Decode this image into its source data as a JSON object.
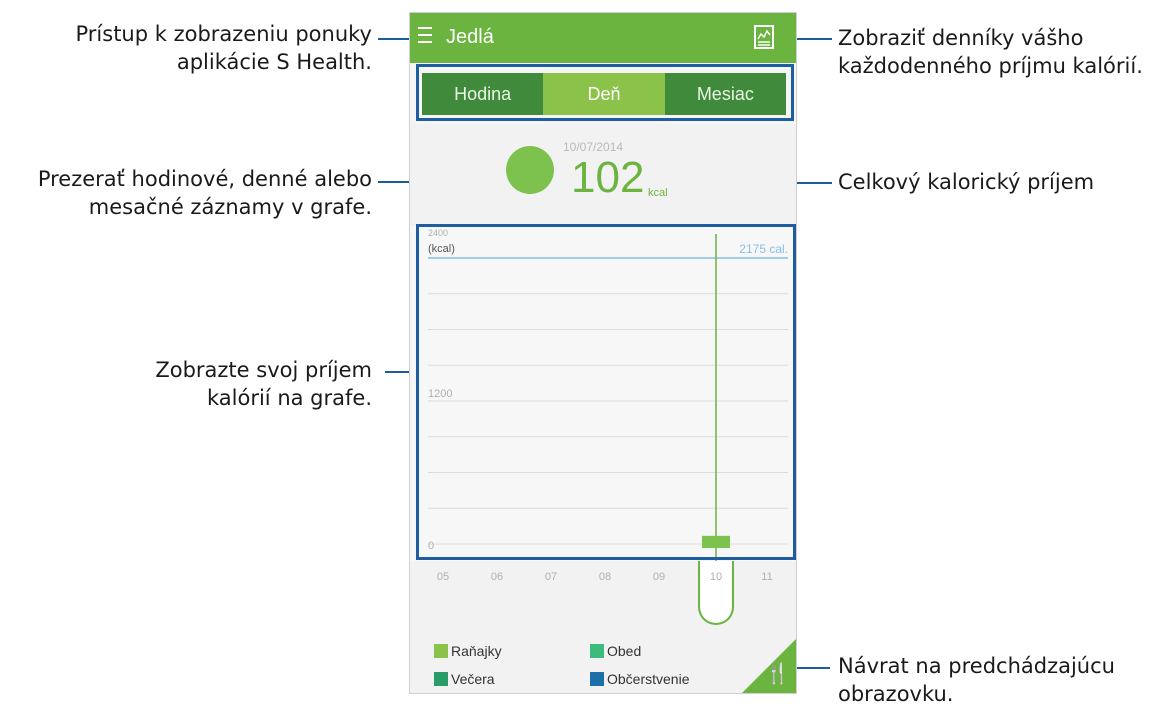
{
  "app": {
    "title": "Jedlá"
  },
  "tabs": [
    {
      "label": "Hodina",
      "active": false
    },
    {
      "label": "Deň",
      "active": true
    },
    {
      "label": "Mesiac",
      "active": false
    }
  ],
  "summary": {
    "date": "10/07/2014",
    "value": "102",
    "unit": "kcal"
  },
  "graph": {
    "top_label": "2400",
    "unit_label": "(kcal)",
    "goal_label": "2175 cal.",
    "mid_tick": "1200",
    "zero_tick": "0",
    "x_ticks": [
      "05",
      "06",
      "07",
      "08",
      "09",
      "10",
      "11"
    ],
    "selected_tick": "10"
  },
  "chart_data": {
    "type": "bar",
    "categories": [
      "05",
      "06",
      "07",
      "08",
      "09",
      "10",
      "11"
    ],
    "values": [
      0,
      0,
      0,
      0,
      0,
      102,
      0
    ],
    "ylabel": "(kcal)",
    "ylim": [
      0,
      2400
    ],
    "goal": 2175,
    "grid": true
  },
  "legend": [
    {
      "label": "Raňajky",
      "color": "#8bc34a"
    },
    {
      "label": "Obed",
      "color": "#3dbb7a"
    },
    {
      "label": "Večera",
      "color": "#2a9c6a"
    },
    {
      "label": "Občerstvenie",
      "color": "#1e6fa8"
    }
  ],
  "annotations": {
    "menu": [
      "Prístup k zobrazeniu ponuky",
      "aplikácie S Health."
    ],
    "logs": [
      "Zobraziť denníky vášho",
      "každodenného príjmu kalórií."
    ],
    "tabs": [
      "Prezerať hodinové, denné alebo",
      "mesačné záznamy v grafe."
    ],
    "total": "Celkový kalorický príjem",
    "graph": [
      "Zobrazte svoj príjem",
      "kalórií na grafe."
    ],
    "back": [
      "Návrat na predchádzajúcu",
      "obrazovku."
    ]
  },
  "colors": {
    "brand_green": "#6bb43f",
    "callout_blue": "#1e5da0"
  }
}
